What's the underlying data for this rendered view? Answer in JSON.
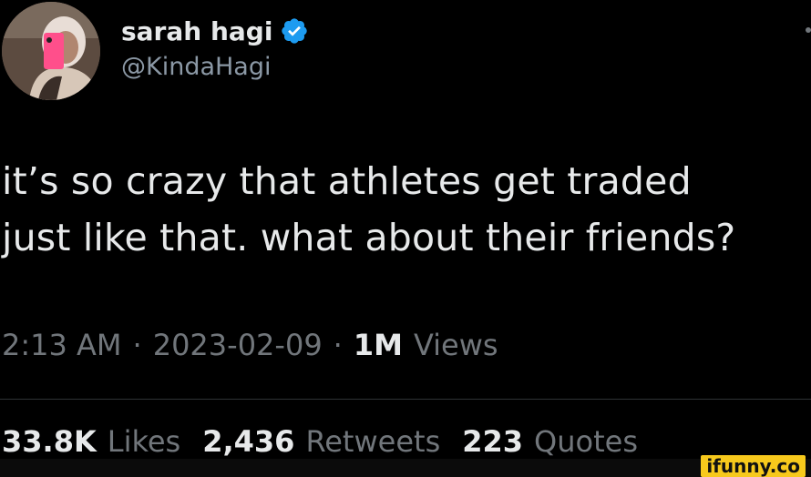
{
  "author": {
    "name": "sarah hagi",
    "handle": "@KindaHagi",
    "verified_icon": "verified-badge-icon"
  },
  "tweet": {
    "lines": [
      "it’s so crazy that athletes get traded",
      "just like that. what about their friends?"
    ]
  },
  "meta": {
    "time": "2:13 AM",
    "separator": "·",
    "date": "2023-02-09",
    "views_count": "1M",
    "views_label": "Views"
  },
  "stats": {
    "likes_count": "33.8K",
    "likes_label": "Likes",
    "retweets_count": "2,436",
    "retweets_label": "Retweets",
    "quotes_count": "223",
    "quotes_label": "Quotes"
  },
  "watermark": {
    "text": "ifunny.co"
  },
  "colors": {
    "background": "#000000",
    "primary_text": "#e7e9ea",
    "secondary_text": "#71767b",
    "verified_blue": "#1d9bf0",
    "watermark_yellow": "#f7c91c"
  }
}
